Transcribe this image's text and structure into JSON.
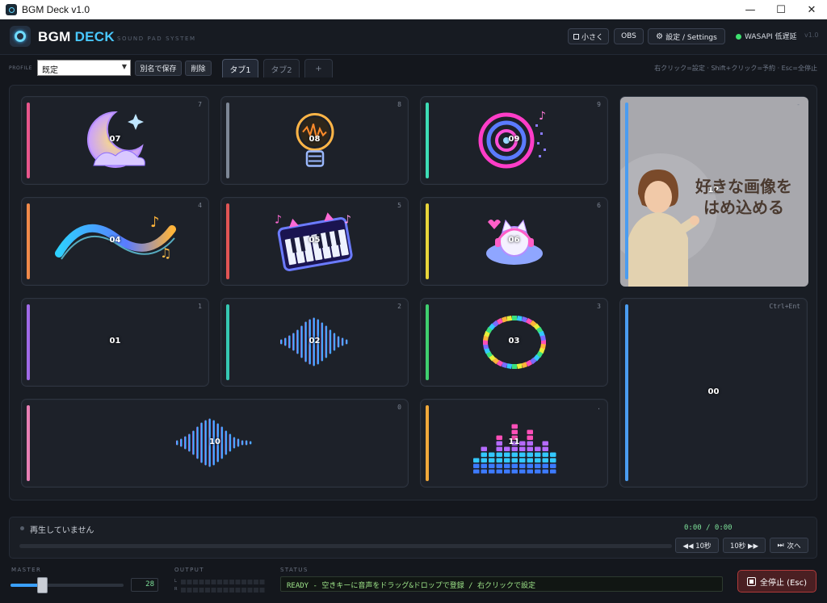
{
  "window": {
    "title": "BGM Deck v1.0",
    "minimize": "—",
    "maximize": "☐",
    "close": "✕"
  },
  "header": {
    "brand_a": "BGM",
    "brand_b": "DECK",
    "subtitle": "SOUND PAD SYSTEM",
    "mini_label": "小さく",
    "obs_label": "OBS",
    "settings_label": "設定 / Settings",
    "audio_status": "WASAPI 低遅延",
    "version": "v1.0"
  },
  "profile": {
    "label": "PROFILE",
    "selected": "既定",
    "save_as_label": "別名で保存",
    "delete_label": "削除",
    "tabs": [
      {
        "label": "タブ1",
        "active": true
      },
      {
        "label": "タブ2",
        "active": false
      }
    ],
    "add_tab_label": "+",
    "hint": "右クリック=設定 · Shift+クリック=予約 · Esc=全停止"
  },
  "pads": [
    {
      "id": "07",
      "key": "7",
      "color": "#e8568c",
      "art": "moon"
    },
    {
      "id": "08",
      "key": "8",
      "color": "#7d8796",
      "art": "bulb"
    },
    {
      "id": "09",
      "key": "9",
      "color": "#3ddcb5",
      "art": "rings"
    },
    {
      "id": "12",
      "key": "-",
      "color": "#4a9cf0",
      "art": "photo",
      "overlay_line1": "好きな画像を",
      "overlay_line2": "はめ込める"
    },
    {
      "id": "04",
      "key": "4",
      "color": "#f0894a",
      "art": "wave"
    },
    {
      "id": "05",
      "key": "5",
      "color": "#e05454",
      "art": "piano"
    },
    {
      "id": "06",
      "key": "6",
      "color": "#e8d53a",
      "art": "cat"
    },
    {
      "id": "01",
      "key": "1",
      "color": "#a06ae8",
      "art": "none"
    },
    {
      "id": "02",
      "key": "2",
      "color": "#36c7b3",
      "art": "sound"
    },
    {
      "id": "03",
      "key": "3",
      "color": "#3fcf6f",
      "art": "ring"
    },
    {
      "id": "00",
      "key": "Ctrl+Ent",
      "color": "#4a9cf0",
      "art": "none"
    },
    {
      "id": "10",
      "key": "0",
      "color": "#e87fb4",
      "art": "sound2"
    },
    {
      "id": "11",
      "key": ".",
      "color": "#f0a83a",
      "art": "eq"
    }
  ],
  "player": {
    "now_playing": "再生していません",
    "time": "0:00 / 0:00",
    "progress": 0,
    "back_label": "◀◀ 10秒",
    "fwd_label": "10秒 ▶▶",
    "next_label": "次へ"
  },
  "bottom": {
    "master_label": "MASTER",
    "master_value": "28",
    "master_level": 0.28,
    "output_label": "OUTPUT",
    "meter_l": "L",
    "meter_r": "R",
    "status_label": "STATUS",
    "status_text": "READY - 空きキーに音声をドラッグ&ドロップで登録 / 右クリックで設定",
    "stop_all_label": "全停止 (Esc)"
  },
  "colors": {
    "accent": "#49c8ff",
    "ready": "#9ee58a",
    "stop": "#b03a3a"
  }
}
